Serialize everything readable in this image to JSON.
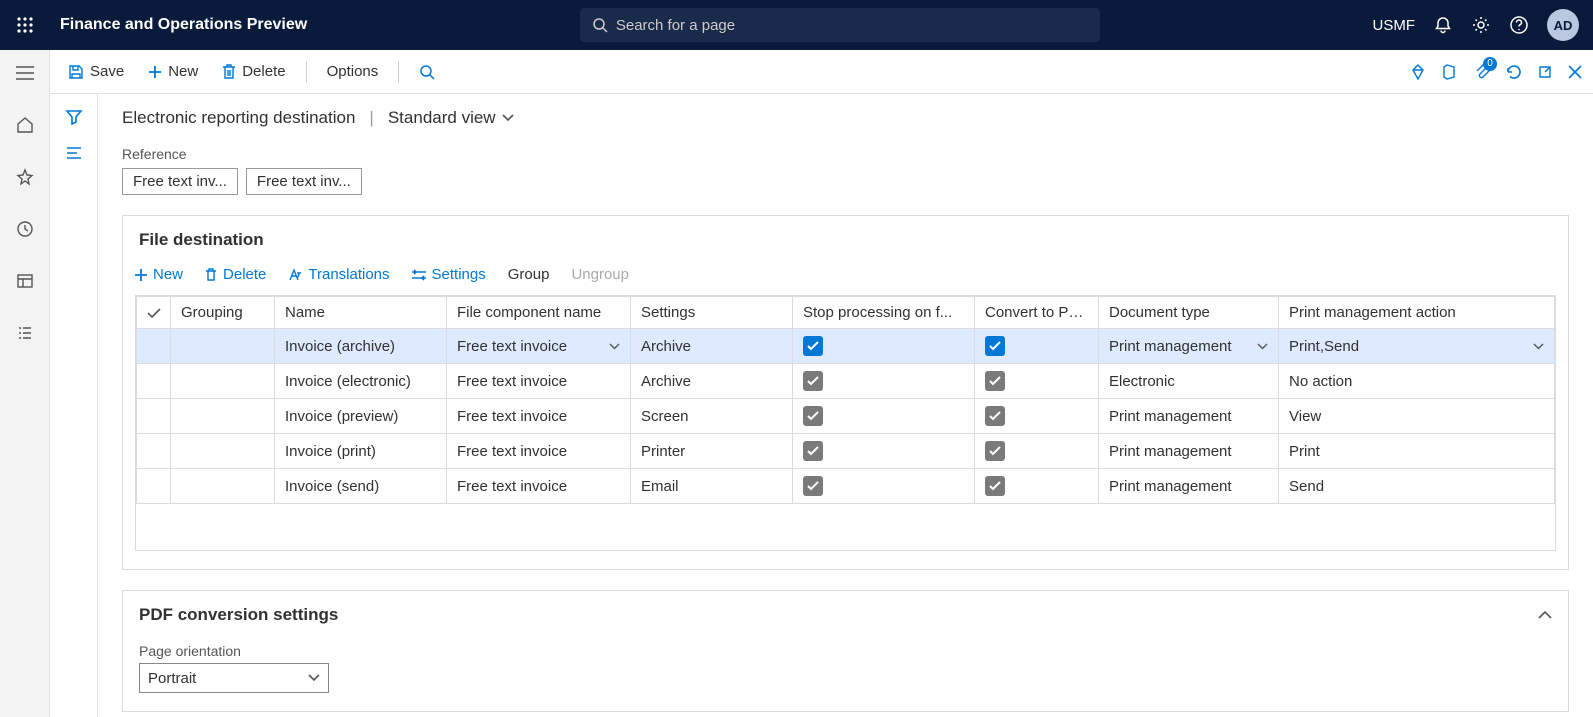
{
  "header": {
    "app_title": "Finance and Operations Preview",
    "search_placeholder": "Search for a page",
    "company": "USMF",
    "avatar_initials": "AD"
  },
  "action_bar": {
    "save": "Save",
    "new": "New",
    "delete": "Delete",
    "options": "Options",
    "attach_count": "0"
  },
  "breadcrumb": {
    "title": "Electronic reporting destination",
    "view": "Standard view"
  },
  "reference": {
    "label": "Reference",
    "chips": [
      "Free text inv...",
      "Free text inv..."
    ]
  },
  "file_destination": {
    "title": "File destination",
    "toolbar": {
      "new": "New",
      "delete": "Delete",
      "translations": "Translations",
      "settings": "Settings",
      "group": "Group",
      "ungroup": "Ungroup"
    },
    "columns": [
      "Grouping",
      "Name",
      "File component name",
      "Settings",
      "Stop processing on f...",
      "Convert to PDF",
      "Document type",
      "Print management action"
    ],
    "rows": [
      {
        "selected": true,
        "name": "Invoice (archive)",
        "component": "Free text invoice",
        "settings": "Archive",
        "stop": true,
        "convert": true,
        "doc_type": "Print management",
        "action": "Print,Send"
      },
      {
        "selected": false,
        "name": "Invoice (electronic)",
        "component": "Free text invoice",
        "settings": "Archive",
        "stop": false,
        "convert": false,
        "doc_type": "Electronic",
        "action": "No action"
      },
      {
        "selected": false,
        "name": "Invoice (preview)",
        "component": "Free text invoice",
        "settings": "Screen",
        "stop": false,
        "convert": false,
        "doc_type": "Print management",
        "action": "View"
      },
      {
        "selected": false,
        "name": "Invoice (print)",
        "component": "Free text invoice",
        "settings": "Printer",
        "stop": false,
        "convert": false,
        "doc_type": "Print management",
        "action": "Print"
      },
      {
        "selected": false,
        "name": "Invoice (send)",
        "component": "Free text invoice",
        "settings": "Email",
        "stop": false,
        "convert": false,
        "doc_type": "Print management",
        "action": "Send"
      }
    ]
  },
  "pdf_settings": {
    "title": "PDF conversion settings",
    "orientation_label": "Page orientation",
    "orientation_value": "Portrait"
  }
}
